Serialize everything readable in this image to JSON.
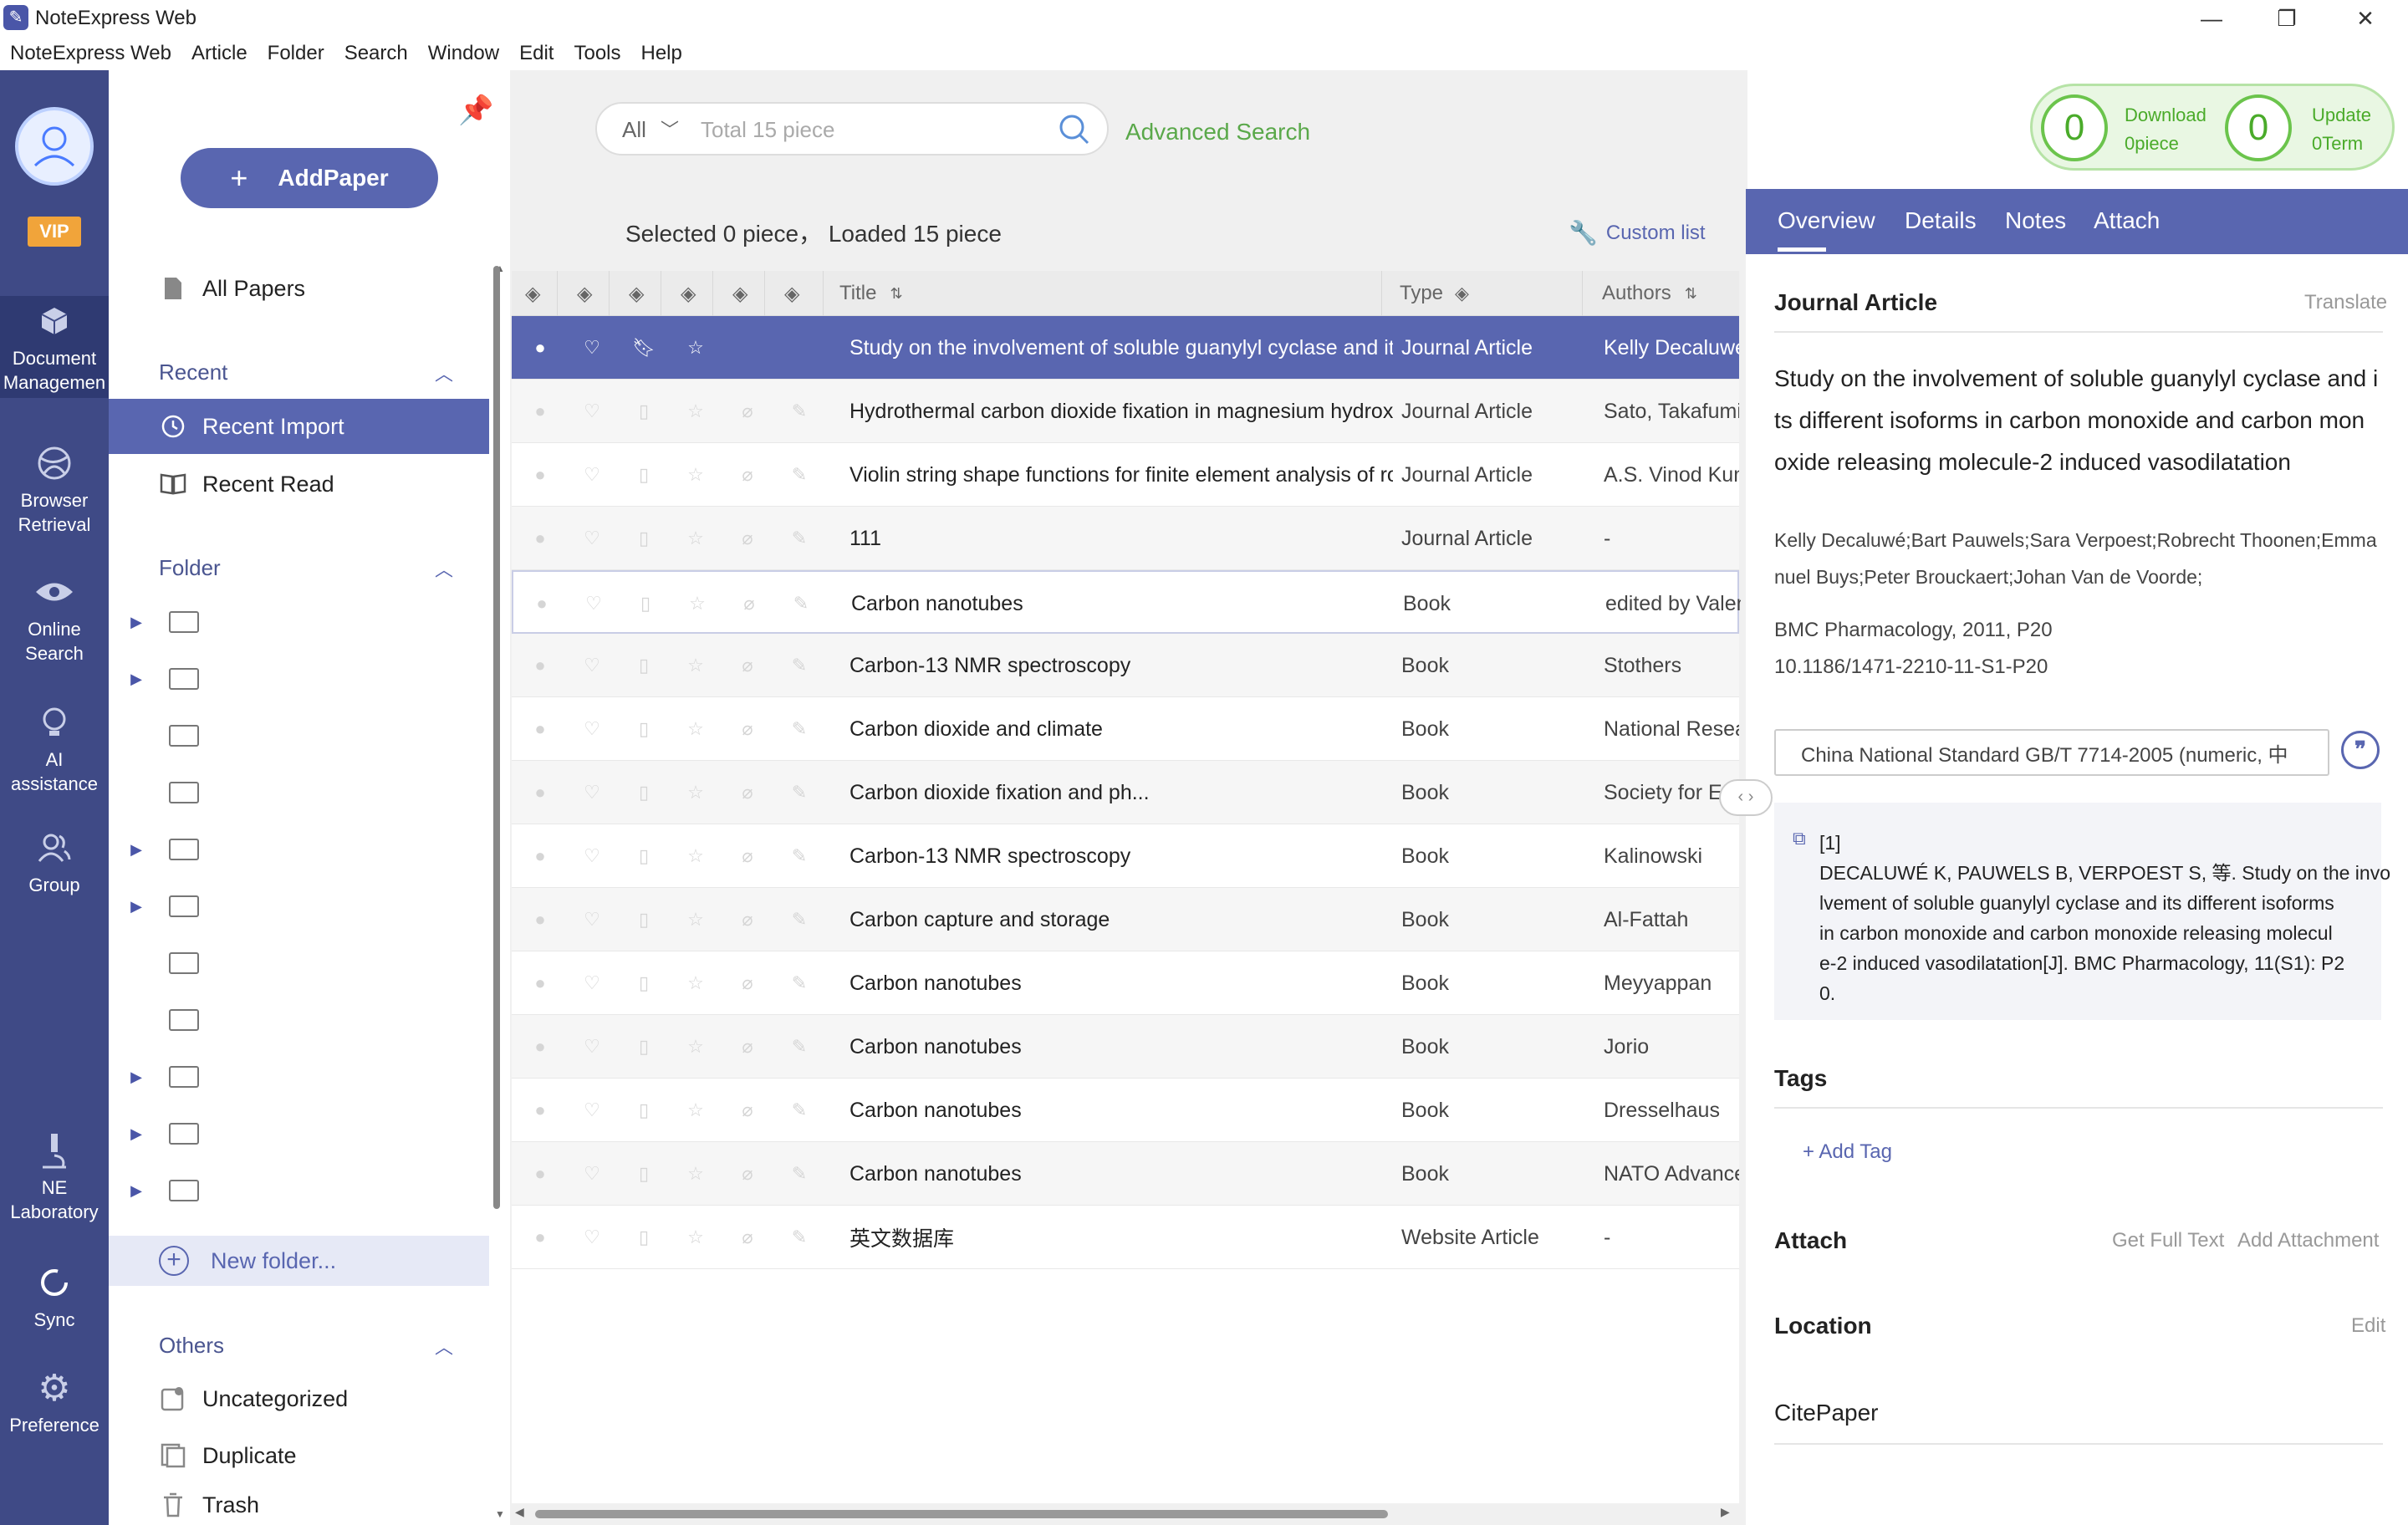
{
  "window": {
    "title": "NoteExpress Web",
    "minimize": "—",
    "maximize": "❐",
    "close": "✕"
  },
  "menu": [
    "NoteExpress Web",
    "Article",
    "Folder",
    "Search",
    "Window",
    "Edit",
    "Tools",
    "Help"
  ],
  "rail": {
    "vip": "VIP",
    "items": [
      {
        "label1": "Document",
        "label2": "Managemen",
        "icon": "cube-icon"
      },
      {
        "label1": "Browser",
        "label2": "Retrieval",
        "icon": "globe-icon"
      },
      {
        "label1": "Online",
        "label2": "Search",
        "icon": "eye-icon"
      },
      {
        "label1": "AI assistance",
        "label2": "",
        "icon": "bulb-icon"
      },
      {
        "label1": "Group",
        "label2": "",
        "icon": "group-icon"
      },
      {
        "label1": "NE",
        "label2": "Laboratory",
        "icon": "microscope-icon"
      },
      {
        "label1": "Sync",
        "label2": "",
        "icon": "sync-icon"
      },
      {
        "label1": "Preference",
        "label2": "",
        "icon": "gear-icon"
      }
    ]
  },
  "sidebar": {
    "add_paper": "AddPaper",
    "all_papers": "All Papers",
    "recent_header": "Recent",
    "recent_import": "Recent Import",
    "recent_read": "Recent Read",
    "folder_header": "Folder",
    "new_folder": "New folder...",
    "others_header": "Others",
    "uncategorized": "Uncategorized",
    "duplicate": "Duplicate",
    "trash": "Trash"
  },
  "search": {
    "scope": "All",
    "placeholder": "Total 15 piece",
    "advanced": "Advanced Search"
  },
  "download": {
    "count": "0",
    "label": "Download",
    "unit": "0piece"
  },
  "update": {
    "count": "0",
    "label": "Update",
    "unit": "0Term"
  },
  "status": "Selected 0 piece， Loaded 15 piece",
  "custom_list": "Custom list",
  "table": {
    "headers": {
      "title": "Title",
      "type": "Type",
      "authors": "Authors"
    },
    "rows": [
      {
        "title": "Study on the involvement of soluble guanylyl cyclase and its different isoforms",
        "type": "Journal Article",
        "authors": "Kelly Decaluwé"
      },
      {
        "title": "Hydrothermal carbon dioxide fixation in magnesium hydroxide",
        "type": "Journal Article",
        "authors": "Sato, Takafumi"
      },
      {
        "title": "Violin string shape functions for finite element analysis of rotating",
        "type": "Journal Article",
        "authors": "A.S. Vinod Kumar"
      },
      {
        "title": "111",
        "type": "Journal Article",
        "authors": "-"
      },
      {
        "title": "Carbon nanotubes",
        "type": "Book",
        "authors": "edited by Valentin"
      },
      {
        "title": "Carbon-13 NMR spectroscopy",
        "type": "Book",
        "authors": "Stothers"
      },
      {
        "title": "Carbon dioxide and climate",
        "type": "Book",
        "authors": "National Research"
      },
      {
        "title": "Carbon dioxide fixation and ph...",
        "type": "Book",
        "authors": "Society for Ex"
      },
      {
        "title": "Carbon-13 NMR spectroscopy",
        "type": "Book",
        "authors": "Kalinowski"
      },
      {
        "title": "Carbon capture and storage",
        "type": "Book",
        "authors": "Al-Fattah"
      },
      {
        "title": "Carbon nanotubes",
        "type": "Book",
        "authors": "Meyyappan"
      },
      {
        "title": "Carbon nanotubes",
        "type": "Book",
        "authors": "Jorio"
      },
      {
        "title": "Carbon nanotubes",
        "type": "Book",
        "authors": "Dresselhaus"
      },
      {
        "title": "Carbon nanotubes",
        "type": "Book",
        "authors": "NATO Advanced"
      },
      {
        "title": "英文数据库",
        "type": "Website Article",
        "authors": "-"
      }
    ]
  },
  "detail": {
    "tabs": [
      "Overview",
      "Details",
      "Notes",
      "Attach"
    ],
    "type": "Journal Article",
    "translate": "Translate",
    "title_lines": [
      "Study on the involvement of soluble guanylyl cyclase and i",
      "ts different isoforms in carbon monoxide and carbon mon",
      "oxide releasing molecule-2 induced vasodilatation"
    ],
    "authors_lines": [
      "Kelly Decaluwé;Bart Pauwels;Sara Verpoest;Robrecht Thoonen;Emma",
      "nuel Buys;Peter Brouckaert;Johan Van de Voorde;"
    ],
    "journal": "BMC Pharmacology, 2011, P20",
    "doi": "10.1186/1471-2210-11-S1-P20",
    "citation_style": "China National Standard GB/T 7714-2005 (numeric, 中",
    "citation_index": "[1]",
    "citation_lines": [
      "DECALUWÉ K, PAUWELS B, VERPOEST S, 等. Study on the invo",
      "lvement of soluble guanylyl cyclase and its different isoforms",
      "in carbon monoxide and carbon monoxide releasing molecul",
      "e-2 induced vasodilatation[J]. BMC Pharmacology, 11(S1): P2",
      "0."
    ],
    "tags_header": "Tags",
    "add_tag": "+ Add Tag",
    "attach_header": "Attach",
    "get_full_text": "Get Full Text",
    "add_attachment": "Add Attachment",
    "location_header": "Location",
    "edit": "Edit",
    "location_value": "CitePaper"
  }
}
